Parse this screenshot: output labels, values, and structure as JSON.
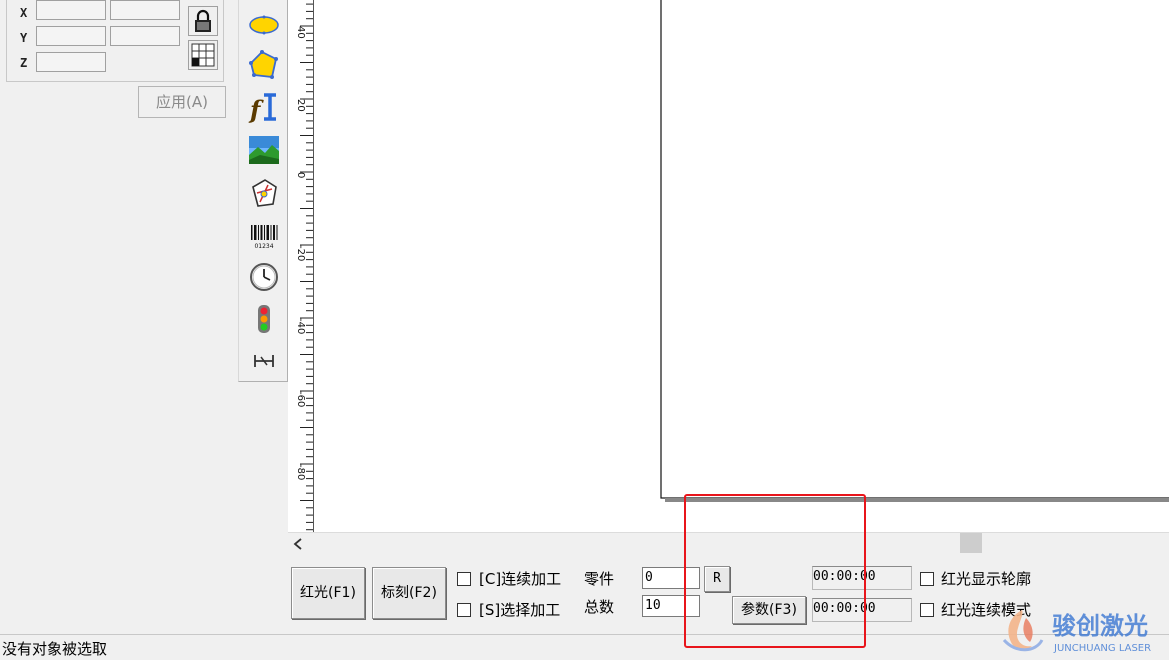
{
  "left_panel": {
    "axis_labels": [
      "X",
      "Y",
      "Z"
    ],
    "lock_icon": "lock-icon",
    "grid_icon": "grid-icon",
    "apply_label": "应用(A)"
  },
  "toolbar": {
    "tools": [
      "ellipse-icon",
      "polygon-icon",
      "text-icon",
      "bitmap-icon",
      "vector-file-icon",
      "barcode-icon",
      "clock-icon",
      "traffic-light-icon",
      "extend-axis-icon"
    ],
    "barcode_text": "01234"
  },
  "ruler": {
    "labels": [
      "40",
      "20",
      "0",
      "-20",
      "-40",
      "-60",
      "-80"
    ]
  },
  "controls": {
    "red_light_label": "红光(F1)",
    "mark_label": "标刻(F2)",
    "continuous_label": "[C]连续加工",
    "selected_label": "[S]选择加工",
    "parts_label": "零件",
    "total_label": "总数",
    "parts_value": "0",
    "total_value": "10",
    "reset_label": "R",
    "params_label": "参数(F3)",
    "time1": "00:00:00",
    "time2": "00:00:00",
    "show_outline_label": "红光显示轮廓",
    "continuous_mode_label": "红光连续模式"
  },
  "status": {
    "text": "没有对象被选取"
  },
  "logo": {
    "cn": "骏创激光",
    "en": "JUNCHUANG LASER"
  },
  "colors": {
    "highlight": "#e8151b",
    "tool_yellow": "#ffd400",
    "logo_blue": "#2f6fd1"
  }
}
